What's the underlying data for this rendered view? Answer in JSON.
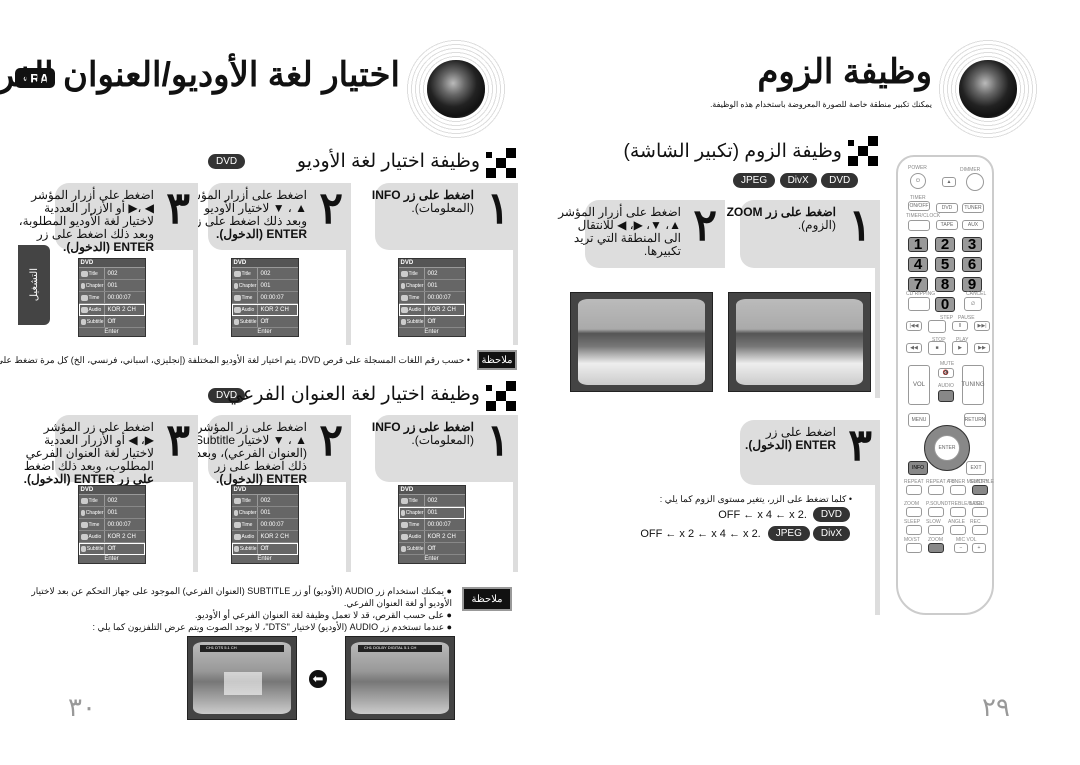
{
  "left_page": {
    "lang_badge": "ARA",
    "title": "اختيار لغة الأوديو/العنوان الفرعي",
    "side_tab": "التشغيل",
    "section_audio": {
      "heading": "وظيفة اختيار لغة الأوديو",
      "disc": "DVD",
      "steps": [
        {
          "num": "١",
          "lines": [
            "اضغط على زر INFO",
            "(المعلومات)."
          ]
        },
        {
          "num": "٢",
          "lines": [
            "اضغط على أزرار المؤشر",
            "▲ ، ▼ لاختيار الأوديو",
            "وبعد ذلك اضغط على زر",
            "ENTER (الدخول)."
          ]
        },
        {
          "num": "٣",
          "lines": [
            "اضغط على أزرار المؤشر",
            "◀ ،▶ أو الأزرار العددية",
            "لاختيار لغة الأوديو المطلوبة،",
            "وبعد ذلك اضغط على زر",
            "ENTER (الدخول)."
          ]
        }
      ],
      "osd_selected": [
        "Audio",
        "Audio",
        "Audio"
      ],
      "note_label": "ملاحظة",
      "note": "• حسب رقم اللغات المسجلة على قرص DVD، يتم اختيار لغة الأوديو المختلفة (إنجليزي، اسباني، فرنسي، الخ) كل مرة تضغط على الزر."
    },
    "section_subtitle": {
      "heading": "وظيفة اختيار لغة العنوان الفرعي",
      "disc": "DVD",
      "steps": [
        {
          "num": "١",
          "lines": [
            "اضغط على زر INFO",
            "(المعلومات)."
          ]
        },
        {
          "num": "٢",
          "lines": [
            "اضغط على زر المؤشر",
            "▲ ، ▼ لاختيار Subtitle",
            "(العنوان الفرعي)، وبعد",
            "ذلك اضغط على زر",
            "ENTER (الدخول)."
          ]
        },
        {
          "num": "٣",
          "lines": [
            "اضغط على زر المؤشر",
            "▶، ◀ أو الأزرار العددية",
            "لاختيار لغة العنوان الفرعي",
            "المطلوب، وبعد ذلك اضغط",
            "على زر ENTER (الدخول)."
          ]
        }
      ],
      "osd_selected": [
        "Chapter",
        "Subtitle",
        "Subtitle"
      ],
      "note_label": "ملاحظة",
      "notes": [
        "● يمكنك استخدام زر AUDIO (الأوديو) أو زر SUBTITLE (العنوان الفرعي) الموجود على جهاز التحكم عن بعد لاختيار",
        "الأوديو أو لغة العنوان الفرعي.",
        "● على حسب القرص، قد لا تعمل وظيفة لغة العنوان الفرعي أو الأوديو.",
        "● عندما تستخدم زر AUDIO (الأوديو) لاختيار \"DTS\"، لا يوجد الصوت ويتم عرض التلفزيون كما يلي :"
      ],
      "tv_before": "CH1 DOLBY DIGITAL 5.1 CH",
      "tv_after": "CH1 DTS 5.1 CH"
    },
    "page_number": "٣٠"
  },
  "right_page": {
    "title": "وظيفة الزوم",
    "subtitle": "يمكنك تكبير منطقة خاصة للصورة المعروضة باستخدام هذه الوظيفة.",
    "section": {
      "heading": "وظيفة الزوم (تكبير الشاشة)",
      "discs": [
        "DVD",
        "DivX",
        "JPEG"
      ],
      "steps": [
        {
          "num": "١",
          "lines": [
            "اضغط على زر ZOOM",
            "(الزوم)."
          ]
        },
        {
          "num": "٢",
          "lines": [
            "اضغط على أزرار المؤشر",
            "▲، ▼، ▶، ◀ للانتقال",
            "الى المنطقة التي تريد",
            "تكبيرها."
          ]
        },
        {
          "num": "٣",
          "lines": [
            "اضغط على زر",
            "ENTER (الدخول)."
          ]
        }
      ],
      "bullet": "• كلما تضغط على الزر، يتغير مستوى الزوم كما يلي :",
      "seq_dvd": {
        "disc": "DVD",
        "text": "OFF ← x 4 ← x 2."
      },
      "seq_divx": {
        "discs": [
          "DivX",
          "JPEG"
        ],
        "text": "OFF ← x 2 ← x 4 ← x 2."
      }
    },
    "page_number": "٢٩"
  },
  "osd": {
    "header": "DVD",
    "rows": [
      [
        "Title",
        "002"
      ],
      [
        "Chapter",
        "001"
      ],
      [
        "Time",
        "00:00:07"
      ],
      [
        "Audio",
        "KOR 2 CH"
      ],
      [
        "Subtitle",
        "Off"
      ]
    ],
    "footer": "Enter"
  },
  "remote": {
    "power": "POWER",
    "dimmer": "DIMMER",
    "timer": "TIMER",
    "onoff": "ON/OFF",
    "timerclock": "TIMER/CLOCK",
    "dvd": "DVD",
    "tuner": "TUNER",
    "tape": "TAPE",
    "aux": "AUX",
    "numbers": [
      "1",
      "2",
      "3",
      "4",
      "5",
      "6",
      "7",
      "8",
      "9",
      "0"
    ],
    "cd_ripping": "CD RIPPING",
    "cancel": "CANCEL",
    "step": "STEP",
    "pause": "PAUSE",
    "stop": "STOP",
    "play": "PLAY",
    "mute": "MUTE",
    "vol": "VOL",
    "audio": "AUDIO",
    "tuning": "TUNING",
    "menu": "MENU",
    "return": "RETURN",
    "enter": "ENTER",
    "info": "INFO",
    "exit": "EXIT",
    "row1": [
      "REPEAT",
      "REPEAT A-B",
      "TUNER MEMORY",
      "SUBTITLE"
    ],
    "row2": [
      "ZOOM",
      "P.SOUND",
      "TREBLE/BASS",
      "LOGO"
    ],
    "row3": [
      "SLEEP",
      "SLOW",
      "ANGLE",
      "REC"
    ],
    "row4": [
      "MO/ST",
      "ZOOM",
      "MIC VOL"
    ],
    "highlight_color": "#888888"
  }
}
